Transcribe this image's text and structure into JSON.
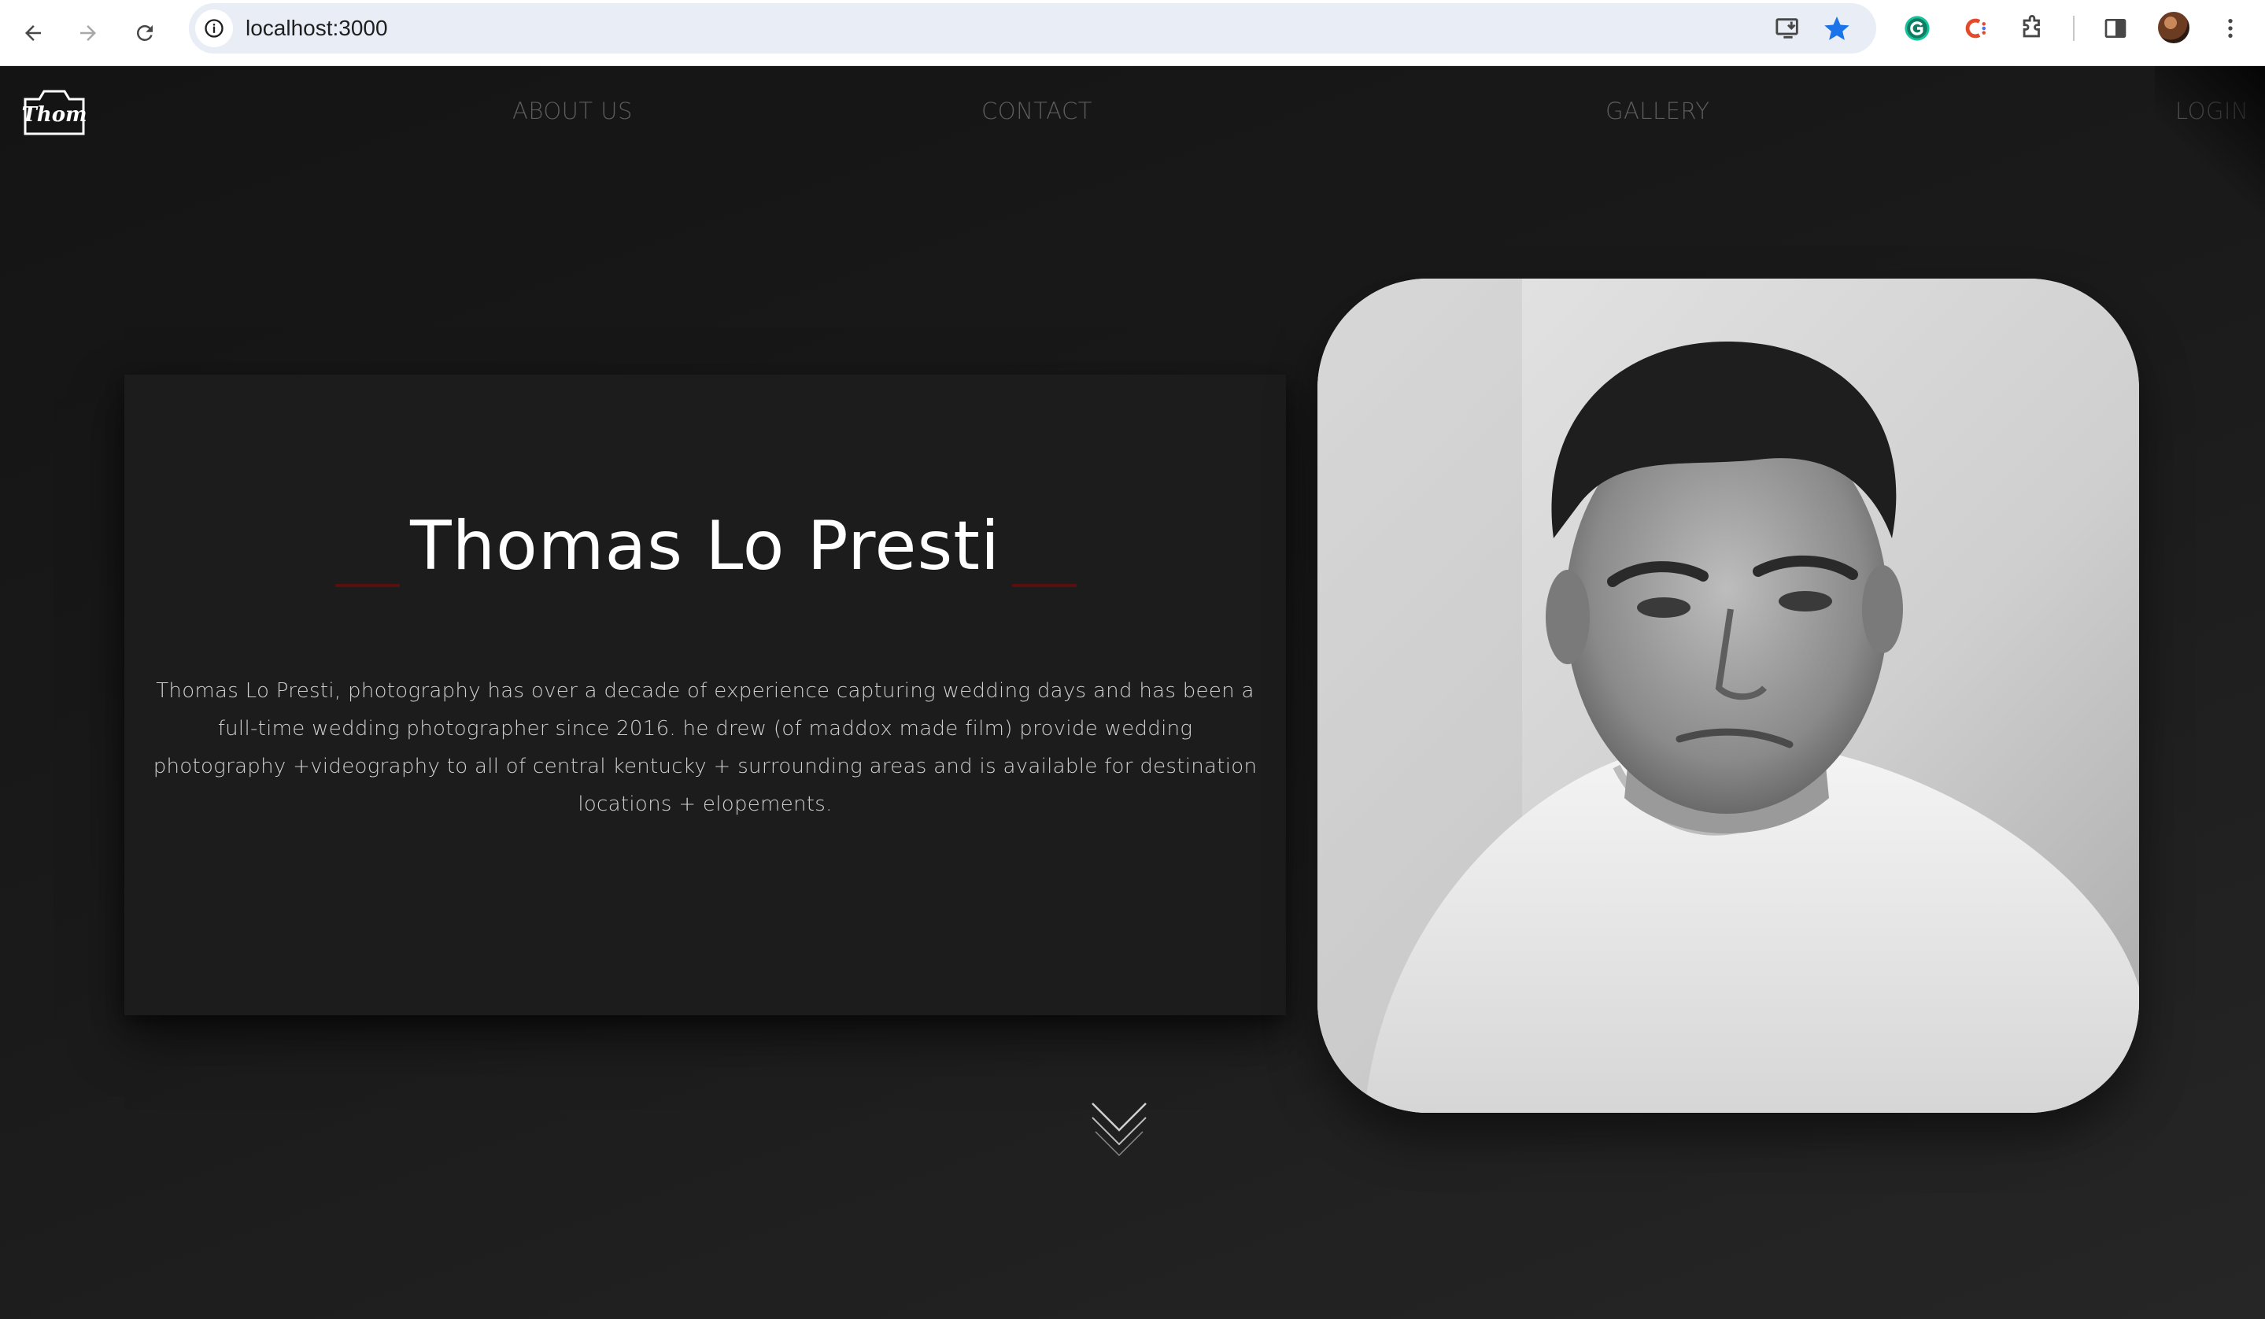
{
  "browser": {
    "url": "localhost:3000"
  },
  "site": {
    "logo_text": "Thom",
    "nav": {
      "about": "ABOUT US",
      "contact": "CONTACT",
      "gallery": "GALLERY",
      "login": "LOGIN"
    }
  },
  "intro": {
    "title": "Thomas Lo Presti",
    "bio": "Thomas Lo Presti, photography has over a decade of experience capturing wedding days and has been a full-time wedding photographer since 2016. he drew (of maddox made film) provide wedding photography +videography to all of central kentucky + surrounding areas and is available for destination locations + elopements."
  },
  "colors": {
    "accent_dash": "#5a0f0f",
    "background": "#161616",
    "card": "#1c1c1c",
    "nav_text": "#5c5c5c"
  },
  "icons": {
    "back": "arrow-left-icon",
    "forward": "arrow-right-icon",
    "reload": "reload-icon",
    "scroll": "chevron-down-double-icon"
  }
}
